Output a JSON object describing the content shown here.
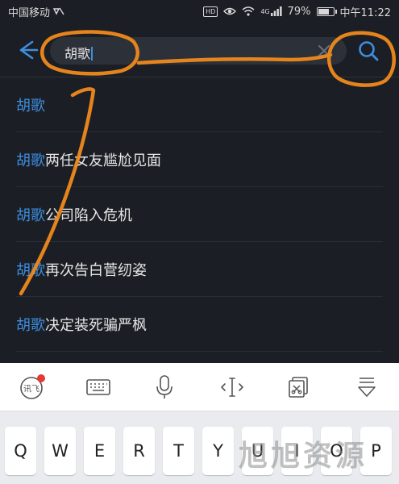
{
  "status_bar": {
    "carrier": "中国移动",
    "hd": "HD",
    "network": "4G",
    "battery_percent": 79,
    "battery_text": "79%",
    "time": "中午11:22"
  },
  "search": {
    "query": "胡歌",
    "back_icon": "arrow-left-icon",
    "clear_icon": "close-icon",
    "search_icon": "search-icon"
  },
  "suggestions": [
    {
      "keyword": "胡歌",
      "rest": ""
    },
    {
      "keyword": "胡歌",
      "rest": "两任女友尴尬见面"
    },
    {
      "keyword": "胡歌",
      "rest": "公司陷入危机"
    },
    {
      "keyword": "胡歌",
      "rest": "再次告白菅纫姿"
    },
    {
      "keyword": "胡歌",
      "rest": "决定装死骗严枫"
    }
  ],
  "keyboard_toolbar": {
    "brand_label": "讯飞",
    "tools": [
      "keyboard-icon",
      "microphone-icon",
      "cursor-icon",
      "clipboard-icon",
      "collapse-icon"
    ]
  },
  "keyboard": {
    "keys": [
      "Q",
      "W",
      "E",
      "R",
      "T",
      "Y",
      "U",
      "I",
      "O",
      "P"
    ]
  },
  "watermark": "旭旭资源",
  "colors": {
    "accent": "#3e8ee0",
    "annotation": "#f08a1c",
    "background": "#1b1e24"
  }
}
